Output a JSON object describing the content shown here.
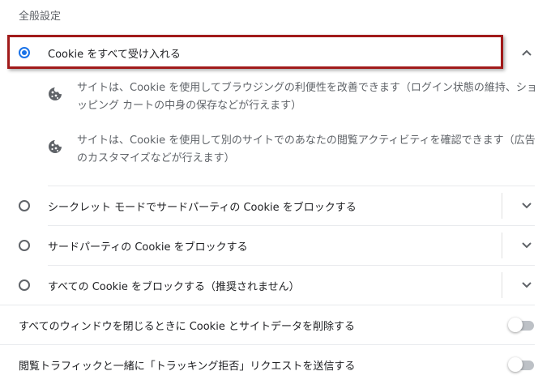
{
  "section": {
    "title": "全般設定"
  },
  "options": [
    {
      "label": "Cookie をすべて受け入れる",
      "selected": true,
      "expanded": true,
      "descriptions": [
        {
          "icon": "cookie-icon",
          "text": "サイトは、Cookie を使用してブラウジングの利便性を改善できます（ログイン状態の維持、ショッピング カートの中身の保存などが行えます）"
        },
        {
          "icon": "cookie-icon",
          "text": "サイトは、Cookie を使用して別のサイトでのあなたの閲覧アクティビティを確認できます（広告のカスタマイズなどが行えます）"
        }
      ]
    },
    {
      "label": "シークレット モードでサードパーティの Cookie をブロックする",
      "selected": false,
      "expanded": false
    },
    {
      "label": "サードパーティの Cookie をブロックする",
      "selected": false,
      "expanded": false
    },
    {
      "label": "すべての Cookie をブロックする（推奨されません）",
      "selected": false,
      "expanded": false
    }
  ],
  "toggles": [
    {
      "label": "すべてのウィンドウを閉じるときに Cookie とサイトデータを削除する",
      "on": false
    },
    {
      "label": "閲覧トラフィックと一緒に「トラッキング拒否」リクエストを送信する",
      "on": false
    }
  ],
  "colors": {
    "accent": "#1a73e8",
    "highlight": "#a11a1a",
    "secondary_text": "#5f6368"
  }
}
